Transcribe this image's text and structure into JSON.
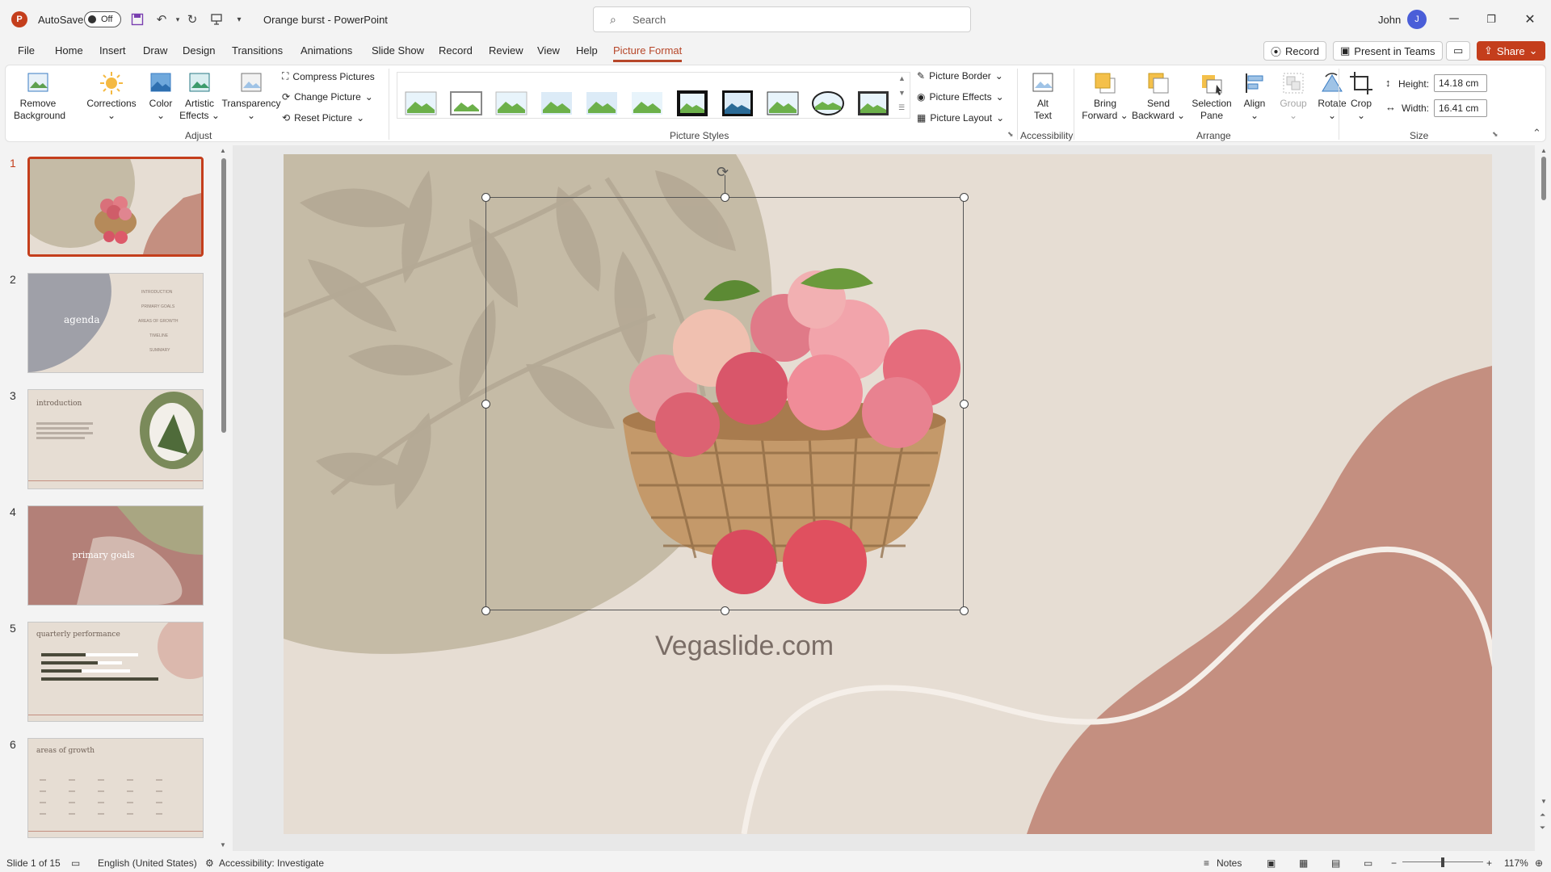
{
  "titlebar": {
    "autosave_label": "AutoSave",
    "autosave_state": "Off",
    "doc_title": "Orange burst  -  PowerPoint",
    "search_placeholder": "Search",
    "user_name": "John",
    "user_initial": "J"
  },
  "tabs": [
    "File",
    "Home",
    "Insert",
    "Draw",
    "Design",
    "Transitions",
    "Animations",
    "Slide Show",
    "Record",
    "Review",
    "View",
    "Help",
    "Picture Format"
  ],
  "active_tab": "Picture Format",
  "tab_right": {
    "record": "Record",
    "present": "Present in Teams",
    "share": "Share"
  },
  "ribbon": {
    "adjust": {
      "remove_background": [
        "Remove",
        "Background"
      ],
      "corrections": "Corrections",
      "color": "Color",
      "artistic_effects": [
        "Artistic",
        "Effects"
      ],
      "transparency": "Transparency",
      "compress": "Compress Pictures",
      "change": "Change Picture",
      "reset": "Reset Picture",
      "label": "Adjust"
    },
    "picture_styles": {
      "border": "Picture Border",
      "effects": "Picture Effects",
      "layout": "Picture Layout",
      "label": "Picture Styles"
    },
    "accessibility": {
      "alt_text": [
        "Alt",
        "Text"
      ],
      "label": "Accessibility"
    },
    "arrange": {
      "bring_forward": [
        "Bring",
        "Forward"
      ],
      "send_backward": [
        "Send",
        "Backward"
      ],
      "selection_pane": [
        "Selection",
        "Pane"
      ],
      "align": "Align",
      "group": "Group",
      "rotate": "Rotate",
      "label": "Arrange"
    },
    "size": {
      "crop": "Crop",
      "height_label": "Height:",
      "height_value": "14.18 cm",
      "width_label": "Width:",
      "width_value": "16.41 cm",
      "label": "Size"
    }
  },
  "slides": [
    {
      "num": "1",
      "title": ""
    },
    {
      "num": "2",
      "title": "agenda",
      "items": [
        "INTRODUCTION",
        "PRIMARY GOALS",
        "AREAS OF GROWTH",
        "TIMELINE",
        "SUMMARY"
      ]
    },
    {
      "num": "3",
      "title": "introduction"
    },
    {
      "num": "4",
      "title": "primary goals"
    },
    {
      "num": "5",
      "title": "quarterly performance"
    },
    {
      "num": "6",
      "title": "areas of growth"
    }
  ],
  "slide": {
    "footer_text": "Vegaslide.com"
  },
  "status": {
    "slide_count": "Slide 1 of 15",
    "language": "English (United States)",
    "accessibility": "Accessibility: Investigate",
    "notes": "Notes",
    "zoom": "117%"
  },
  "colors": {
    "accent": "#c43e1c",
    "slide_bg": "#e6ddd3",
    "olive_blob": "#c5bba6",
    "rose_blob": "#c48f80"
  }
}
